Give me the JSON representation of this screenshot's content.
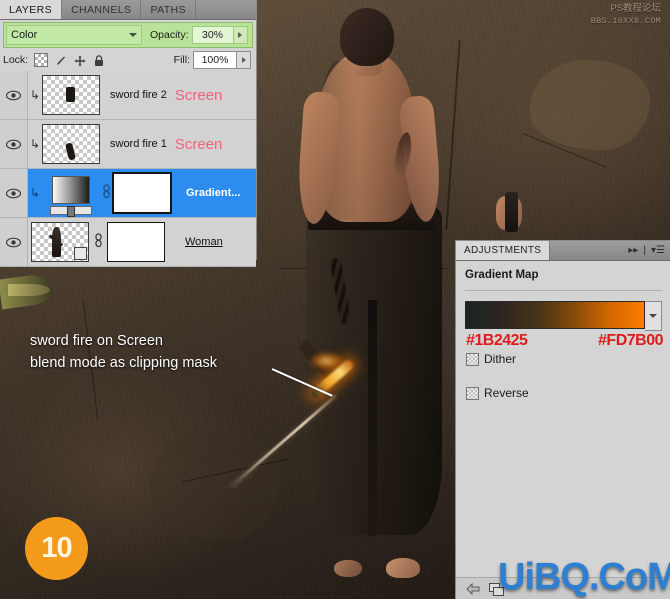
{
  "layers_panel": {
    "tabs": [
      {
        "label": "LAYERS",
        "active": true
      },
      {
        "label": "CHANNELS",
        "active": false
      },
      {
        "label": "PATHS",
        "active": false
      }
    ],
    "blend_mode": "Color",
    "opacity_label": "Opacity:",
    "opacity_value": "30%",
    "lock_label": "Lock:",
    "lock_icons": [
      "lock-transparency-icon",
      "lock-image-icon",
      "lock-position-icon",
      "lock-all-icon"
    ],
    "fill_label": "Fill:",
    "fill_value": "100%",
    "rows": [
      {
        "name": "sword fire 2",
        "mode_tag": "Screen",
        "selected": false,
        "clipped": true,
        "kind": "pixel"
      },
      {
        "name": "sword fire 1",
        "mode_tag": "Screen",
        "selected": false,
        "clipped": true,
        "kind": "pixel"
      },
      {
        "name": "Gradient...",
        "mode_tag": "",
        "selected": true,
        "clipped": true,
        "kind": "gradient-map"
      },
      {
        "name": "Woman",
        "mode_tag": "",
        "selected": false,
        "clipped": false,
        "kind": "smart-object"
      }
    ]
  },
  "adjustments_panel": {
    "tab_label": "ADJUSTMENTS",
    "title": "Gradient Map",
    "gradient_start_hex": "#1B2425",
    "gradient_end_hex": "#FD7B00",
    "dither_label": "Dither",
    "dither_checked": false,
    "reverse_label": "Reverse",
    "reverse_checked": false,
    "footer_icons": [
      "back-arrow-icon",
      "clip-to-layer-icon"
    ]
  },
  "annotation": {
    "line1": "sword fire on Screen",
    "line2": "blend mode as clipping mask",
    "step_badge": "10"
  },
  "watermarks": {
    "top_line1": "PS教程论坛",
    "top_line2": "BBS.16XX8.COM",
    "bottom": "UiBQ.CoM"
  },
  "colors": {
    "selection_blue": "#2d8cf0",
    "screen_tag": "#f2607f",
    "hex_text_red": "#e01b1b",
    "badge_orange": "#f59b1c",
    "blend_bar_green": "#b8e398",
    "watermark_blue": "#2f7fd0"
  }
}
